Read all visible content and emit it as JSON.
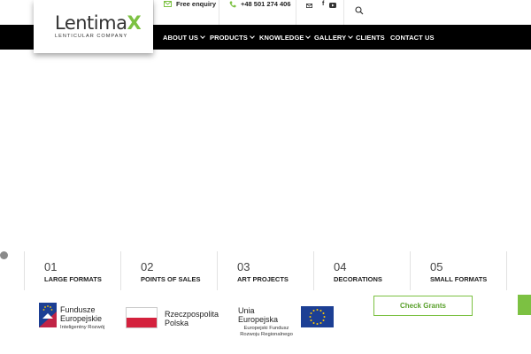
{
  "topbar": {
    "enquiry_label": "Free enquiry",
    "phone": "+48 501 274 406",
    "social_icons": [
      "mail-icon",
      "facebook-icon",
      "youtube-icon"
    ],
    "search_icon": "search-icon"
  },
  "logo": {
    "word_main": "Lentima",
    "word_accent": "X",
    "subtitle": "LENTICULAR COMPANY",
    "accent_color": "#7cc142"
  },
  "nav": {
    "items": [
      {
        "label": "ABOUT US",
        "dropdown": true
      },
      {
        "label": "PRODUCTS",
        "dropdown": true
      },
      {
        "label": "KNOWLEDGE",
        "dropdown": true
      },
      {
        "label": "GALLERY",
        "dropdown": true
      },
      {
        "label": "CLIENTS",
        "dropdown": false
      },
      {
        "label": "CONTACT US",
        "dropdown": false
      }
    ]
  },
  "strip": {
    "items": [
      {
        "num": "01",
        "label": "LARGE FORMATS"
      },
      {
        "num": "02",
        "label": "POINTS OF SALES"
      },
      {
        "num": "03",
        "label": "ART PROJECTS"
      },
      {
        "num": "04",
        "label": "DECORATIONS"
      },
      {
        "num": "05",
        "label": "SMALL FORMATS"
      }
    ]
  },
  "funding": {
    "fe_title_1": "Fundusze",
    "fe_title_2": "Europejskie",
    "fe_sub": "Inteligentny Rozwój",
    "rp_title_1": "Rzeczpospolita",
    "rp_title_2": "Polska",
    "ue_title": "Unia Europejska",
    "ue_sub_1": "Europejski Fundusz",
    "ue_sub_2": "Rozwoju Regionalnego",
    "button_label": "Check Grants"
  },
  "colors": {
    "accent": "#7cc142",
    "nav_bg": "#000000",
    "eu_blue": "#1c3f94",
    "eu_yellow": "#ffcc00",
    "pl_red": "#d4213d"
  }
}
